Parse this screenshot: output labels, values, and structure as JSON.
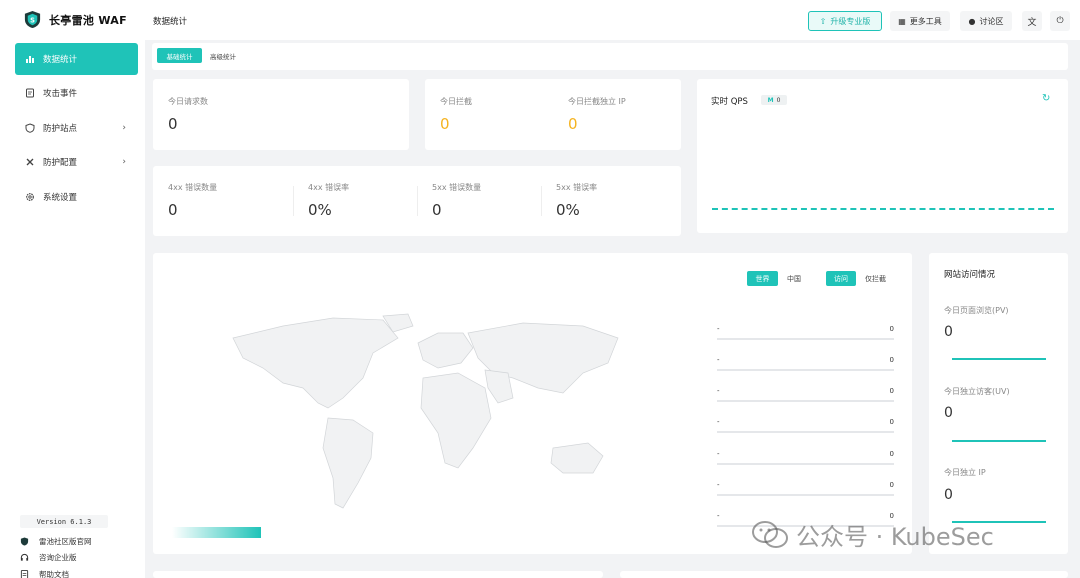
{
  "app": {
    "name": "长亭雷池 WAF",
    "accent": "#1fc3b8"
  },
  "sidebar": {
    "items": [
      {
        "label": "数据统计",
        "icon": "bar-chart-icon",
        "active": true
      },
      {
        "label": "攻击事件",
        "icon": "document-icon"
      },
      {
        "label": "防护站点",
        "icon": "shield-icon",
        "has_children": true
      },
      {
        "label": "防护配置",
        "icon": "tools-icon",
        "has_children": true
      },
      {
        "label": "系统设置",
        "icon": "gear-icon"
      }
    ],
    "version": "Version 6.1.3",
    "links": [
      {
        "label": "雷池社区版官网",
        "icon": "shield-icon"
      },
      {
        "label": "咨询企业版",
        "icon": "headset-icon"
      },
      {
        "label": "帮助文档",
        "icon": "document-icon"
      }
    ]
  },
  "header": {
    "title": "数据统计",
    "upgrade": "升级专业版",
    "more_tools": "更多工具",
    "forum": "讨论区"
  },
  "tabs": [
    "基础统计",
    "高级统计"
  ],
  "stats": {
    "requests_today": {
      "label": "今日请求数",
      "value": "0"
    },
    "blocked_today": {
      "label": "今日拦截",
      "value": "0"
    },
    "blocked_ips_today": {
      "label": "今日拦截独立 IP",
      "value": "0"
    },
    "err4xx_count": {
      "label": "4xx 错误数量",
      "value": "0"
    },
    "err4xx_rate": {
      "label": "4xx 错误率",
      "value": "0%"
    },
    "err5xx_count": {
      "label": "5xx 错误数量",
      "value": "0"
    },
    "err5xx_rate": {
      "label": "5xx 错误率",
      "value": "0%"
    }
  },
  "qps": {
    "label": "实时 QPS",
    "value": "0"
  },
  "map": {
    "scope": [
      "世界",
      "中国"
    ],
    "mode": [
      "访问",
      "仅拦截"
    ],
    "ranking": [
      {
        "name": "-",
        "value": "0"
      },
      {
        "name": "-",
        "value": "0"
      },
      {
        "name": "-",
        "value": "0"
      },
      {
        "name": "-",
        "value": "0"
      },
      {
        "name": "-",
        "value": "0"
      },
      {
        "name": "-",
        "value": "0"
      },
      {
        "name": "-",
        "value": "0"
      }
    ]
  },
  "visits": {
    "title": "网站访问情况",
    "pv": {
      "label": "今日页面浏览(PV)",
      "value": "0"
    },
    "uv": {
      "label": "今日独立访客(UV)",
      "value": "0"
    },
    "ip": {
      "label": "今日独立 IP",
      "value": "0"
    }
  },
  "watermark": {
    "text": "公众号 · KubeSec"
  }
}
